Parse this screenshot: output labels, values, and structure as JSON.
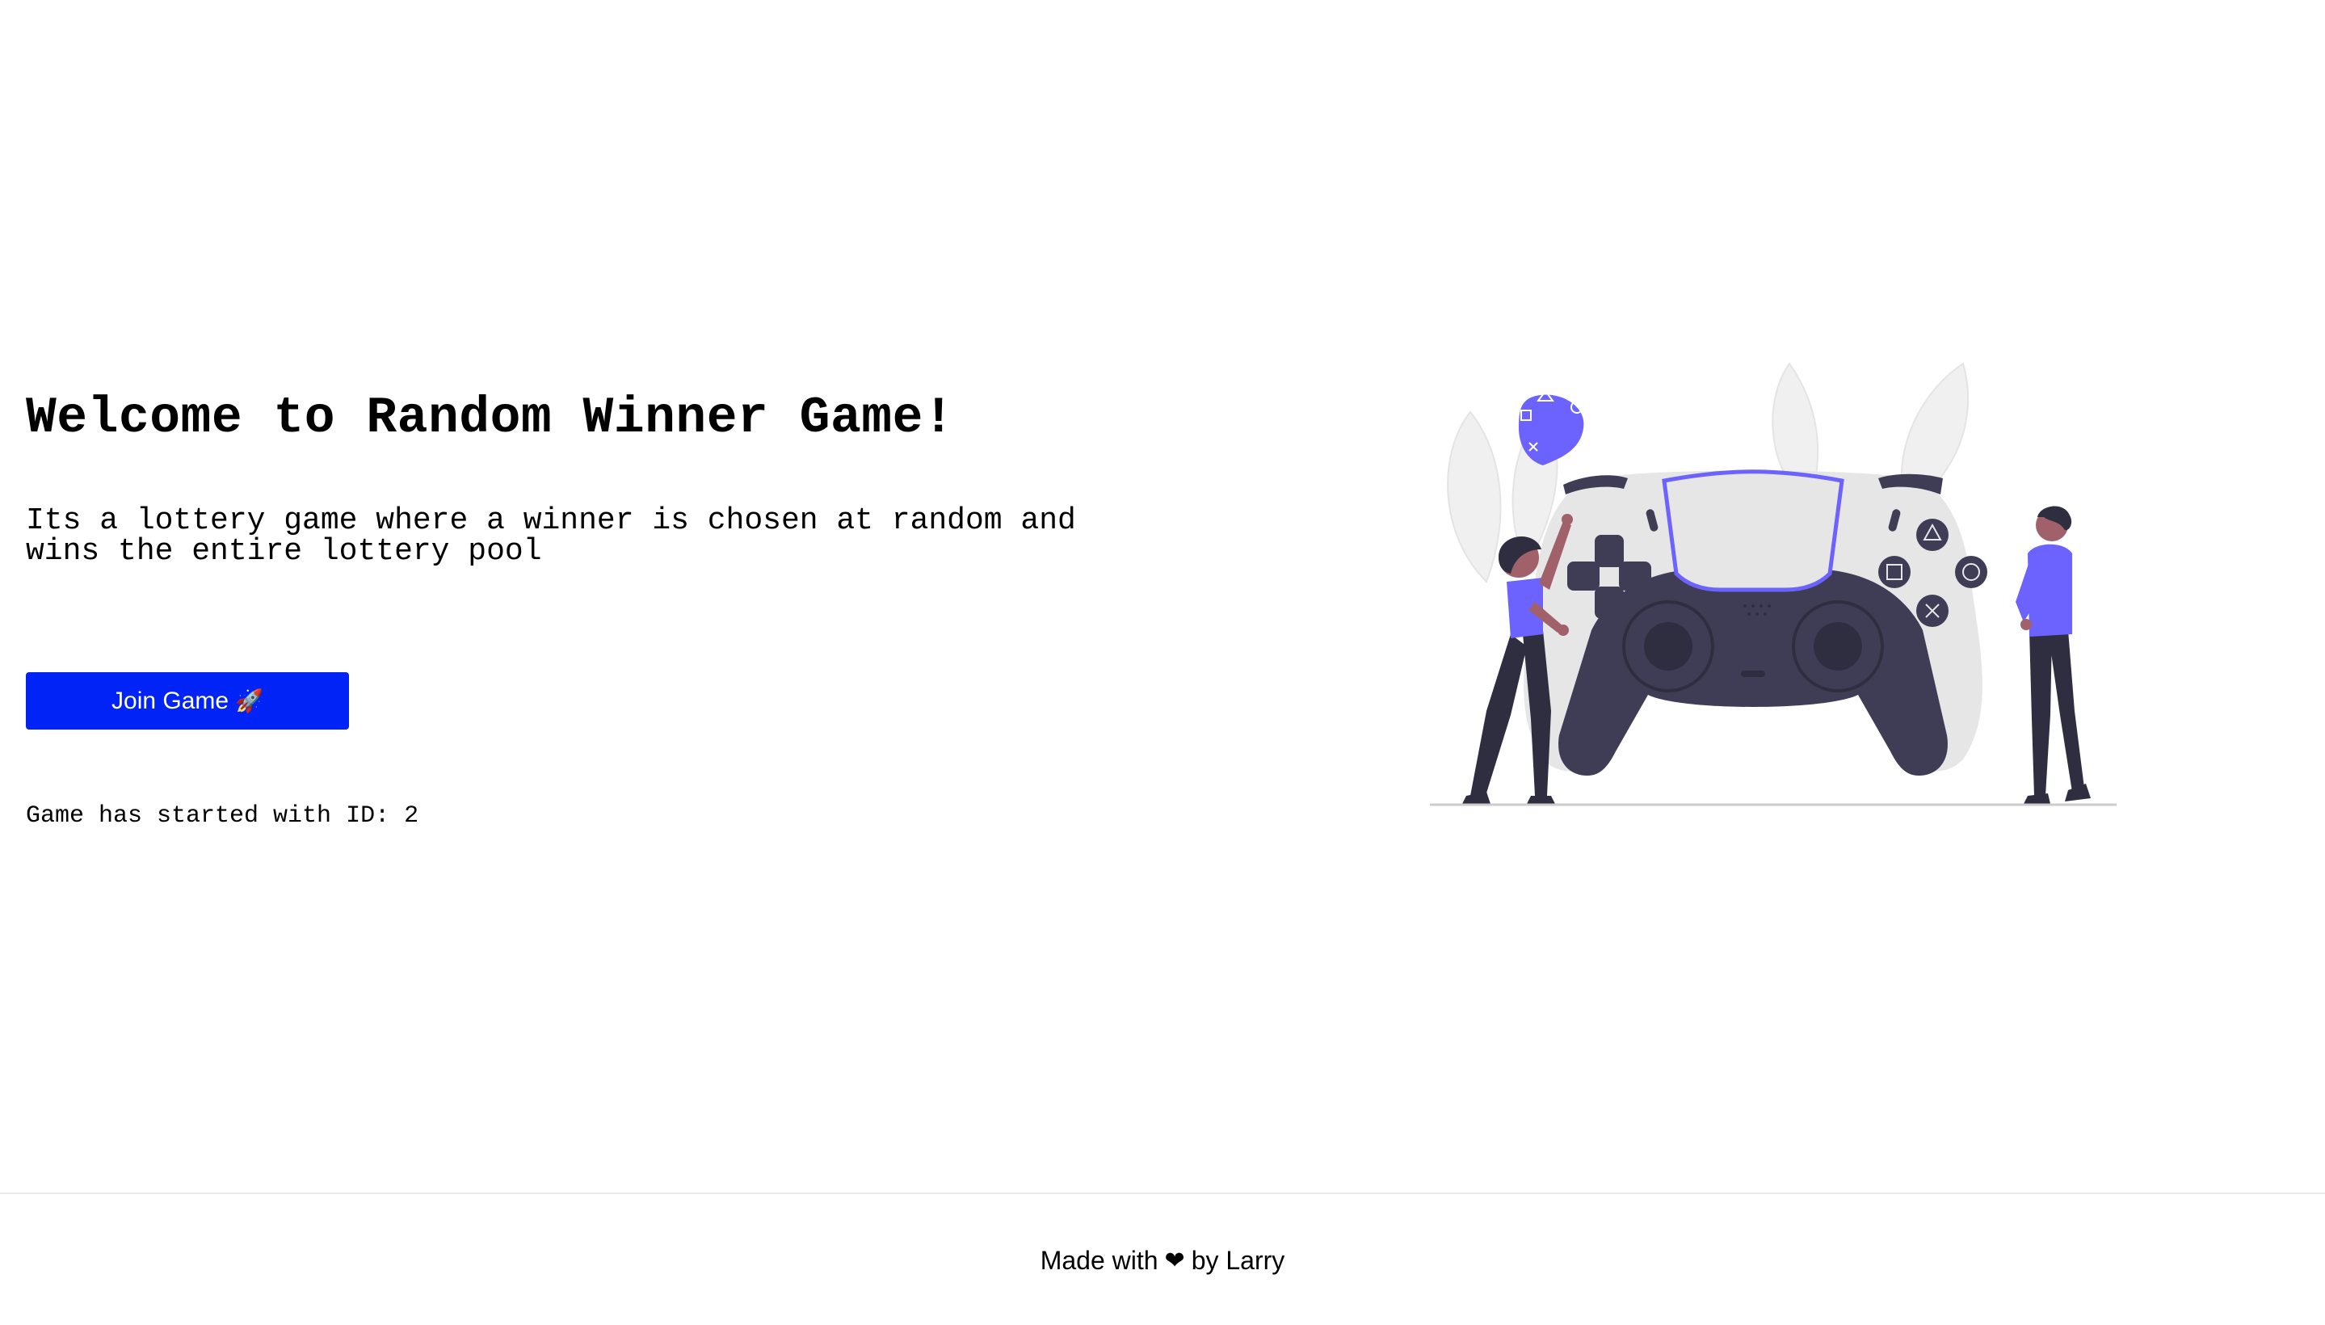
{
  "hero": {
    "title": "Welcome to Random Winner Game!",
    "description": "Its a lottery game where a winner is chosen at random and wins the entire lottery pool",
    "join_button_label": "Join Game",
    "join_button_icon": "🚀",
    "status_text": "Game has started with ID: 2"
  },
  "illustration": {
    "icon": "game-controller-illustration"
  },
  "footer": {
    "text_before": "Made with",
    "heart_icon": "❤",
    "text_after": "by Larry"
  },
  "colors": {
    "button": "#0123f6",
    "accent": "#6c63ff",
    "controller_dark": "#3f3d56",
    "controller_light": "#e6e6e6"
  }
}
